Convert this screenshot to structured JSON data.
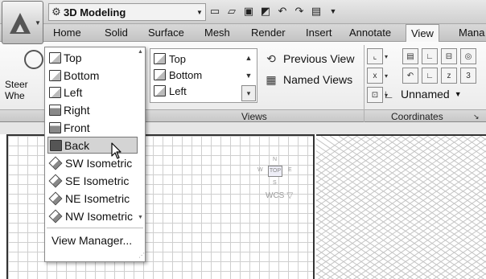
{
  "titlebar": {
    "workspace": {
      "label": "3D Modeling",
      "icon": "gear-icon"
    },
    "quick_access": [
      "new-icon",
      "open-icon",
      "save-icon",
      "saveas-icon",
      "undo-icon",
      "redo-icon",
      "plot-icon",
      "customize-icon"
    ]
  },
  "tabs": [
    {
      "label": "Home",
      "active": false
    },
    {
      "label": "Solid",
      "active": false
    },
    {
      "label": "Surface",
      "active": false
    },
    {
      "label": "Mesh",
      "active": false
    },
    {
      "label": "Render",
      "active": false
    },
    {
      "label": "Insert",
      "active": false
    },
    {
      "label": "Annotate",
      "active": false
    },
    {
      "label": "View",
      "active": true
    },
    {
      "label": "Mana",
      "active": false
    }
  ],
  "ribbon": {
    "steering_wheel": {
      "line1": "Steer",
      "line2": "Whe"
    },
    "gallery": {
      "items": [
        "Top",
        "Bottom",
        "Left"
      ]
    },
    "previous_view": "Previous View",
    "named_views": "Named Views",
    "unnamed": "Unnamed",
    "panel_labels": {
      "views": "Views",
      "coordinates": "Coordinates"
    }
  },
  "dropdown": {
    "items": [
      {
        "label": "Top",
        "icon": "top-view-icon",
        "selected": false
      },
      {
        "label": "Bottom",
        "icon": "bottom-view-icon",
        "selected": false
      },
      {
        "label": "Left",
        "icon": "left-view-icon",
        "selected": false
      },
      {
        "label": "Right",
        "icon": "right-view-icon",
        "selected": false
      },
      {
        "label": "Front",
        "icon": "front-view-icon",
        "selected": false
      },
      {
        "label": "Back",
        "icon": "back-view-icon",
        "selected": true
      },
      {
        "label": "SW Isometric",
        "icon": "sw-isometric-icon",
        "selected": false
      },
      {
        "label": "SE Isometric",
        "icon": "se-isometric-icon",
        "selected": false
      },
      {
        "label": "NE Isometric",
        "icon": "ne-isometric-icon",
        "selected": false
      },
      {
        "label": "NW Isometric",
        "icon": "nw-isometric-icon",
        "selected": false
      }
    ],
    "footer": "View Manager..."
  },
  "viewcube": {
    "face": "TOP",
    "n": "N",
    "s": "S",
    "w": "W",
    "e": "E",
    "wcs": "WCS"
  }
}
